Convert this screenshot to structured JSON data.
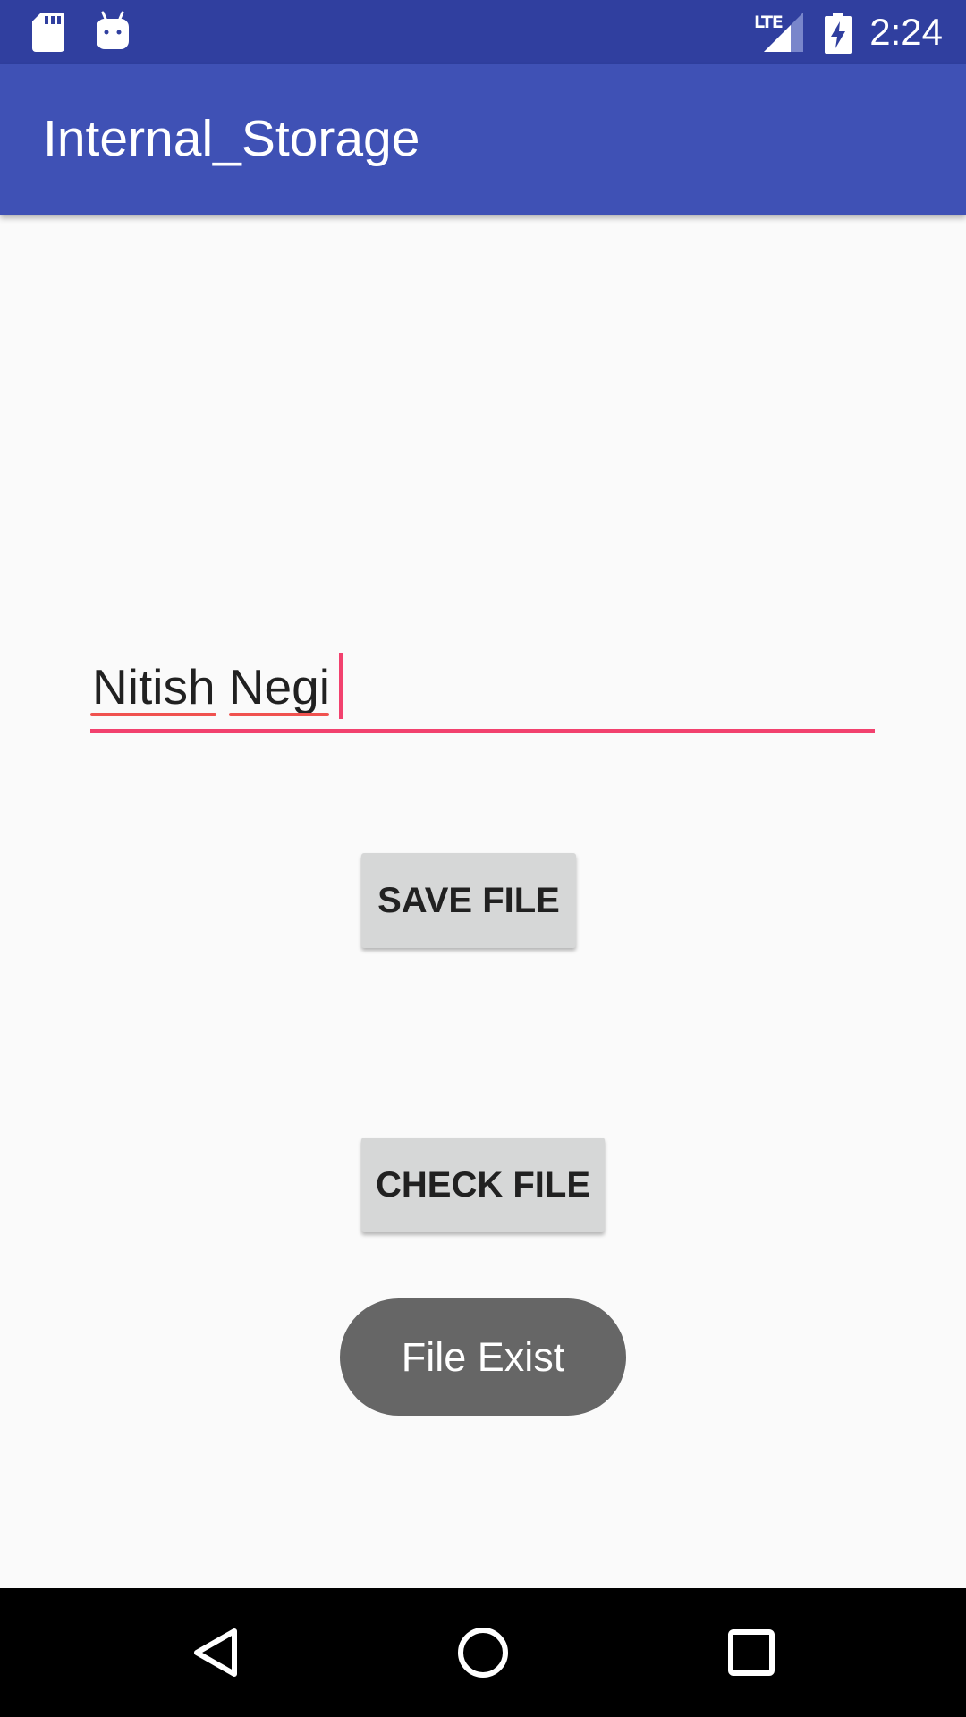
{
  "status_bar": {
    "icons": [
      "sd-card-icon",
      "android-icon",
      "lte-icon",
      "signal-icon",
      "battery-charging-icon"
    ],
    "network_label": "LTE",
    "time": "2:24"
  },
  "app_bar": {
    "title": "Internal_Storage"
  },
  "edit_text": {
    "value": "Nitish Negi"
  },
  "buttons": {
    "save_label": "SAVE FILE",
    "check_label": "CHECK FILE"
  },
  "toast": {
    "message": "File Exist"
  },
  "nav_bar": {
    "icons": [
      "back-icon",
      "home-icon",
      "recents-icon"
    ]
  },
  "colors": {
    "status_bar": "#303f9f",
    "app_bar": "#3f51b5",
    "accent": "#f2416e",
    "spellcheck": "#f0524f",
    "button_bg": "#d6d7d7",
    "toast_bg": "#666666",
    "background": "#fafafa"
  }
}
